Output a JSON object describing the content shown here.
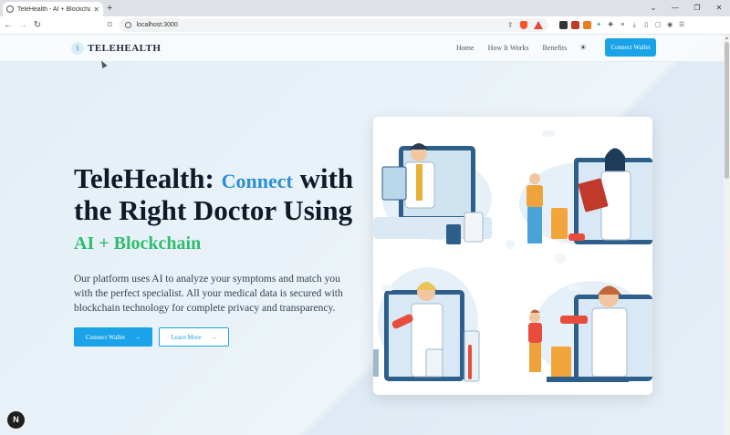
{
  "browser": {
    "tab_title": "TeleHealth - AI + Blockchain H...",
    "url": "localhost:3000"
  },
  "header": {
    "logo_text": "TELEHEALTH",
    "nav": [
      "Home",
      "How It Works",
      "Benefits"
    ],
    "cta_label": "Connect Wallet"
  },
  "hero": {
    "title_part1": "TeleHealth: ",
    "title_highlight1": "Connect",
    "title_part2": " with the Right Doctor Using ",
    "title_highlight2": "AI + Blockchain",
    "description": "Our platform uses AI to analyze your symptoms and match you with the perfect specialist. All your medical data is secured with blockchain technology for complete privacy and transparency.",
    "primary_button": "Connect Wallet",
    "secondary_button": "Learn More"
  },
  "badge": {
    "label": "N"
  },
  "colors": {
    "accent": "#1aa3e8",
    "highlight_blue": "#2b8fd6",
    "highlight_green": "#2ebd6e"
  }
}
